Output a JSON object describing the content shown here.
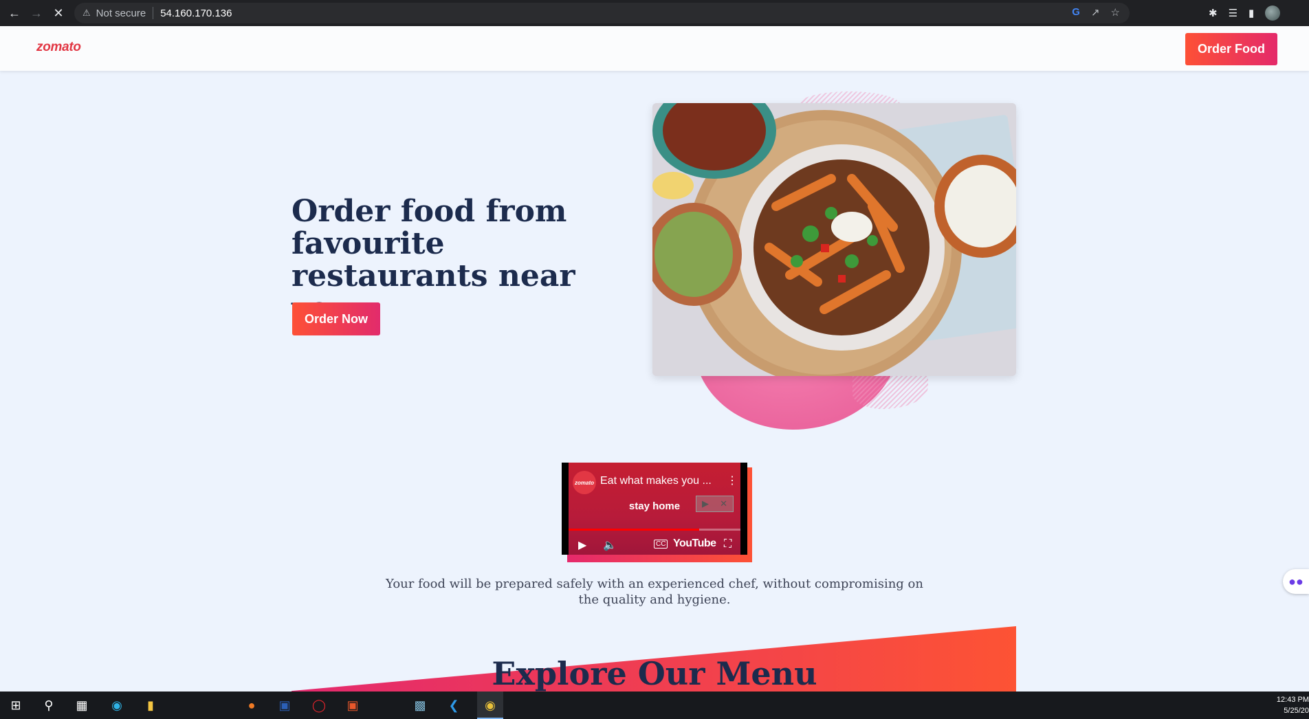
{
  "browser": {
    "security_label": "Not secure",
    "url": "54.160.170.136"
  },
  "header": {
    "logo": "zomato",
    "order_food_label": "Order Food"
  },
  "hero": {
    "title": "Order food from favourite restaurants near you.",
    "order_now_label": "Order Now",
    "image": "food-plate-image"
  },
  "video": {
    "channel_avatar": "zomato",
    "title": "Eat what makes you ...",
    "overlay_text": "stay home",
    "platform_label": "YouTube",
    "progress": 0.76
  },
  "tagline": "Your food will be prepared safely with an experienced chef, without compromising on the quality and hygiene.",
  "menu_section": {
    "title": "Explore Our Menu"
  },
  "taskbar": {
    "time": "12:43 PM",
    "date": "5/25/20"
  },
  "colors": {
    "brand_red": "#e23744",
    "gradient_start": "#fd5036",
    "gradient_end": "#e42a6a",
    "heading_navy": "#1c2b4d",
    "page_bg": "#edf3fd"
  }
}
